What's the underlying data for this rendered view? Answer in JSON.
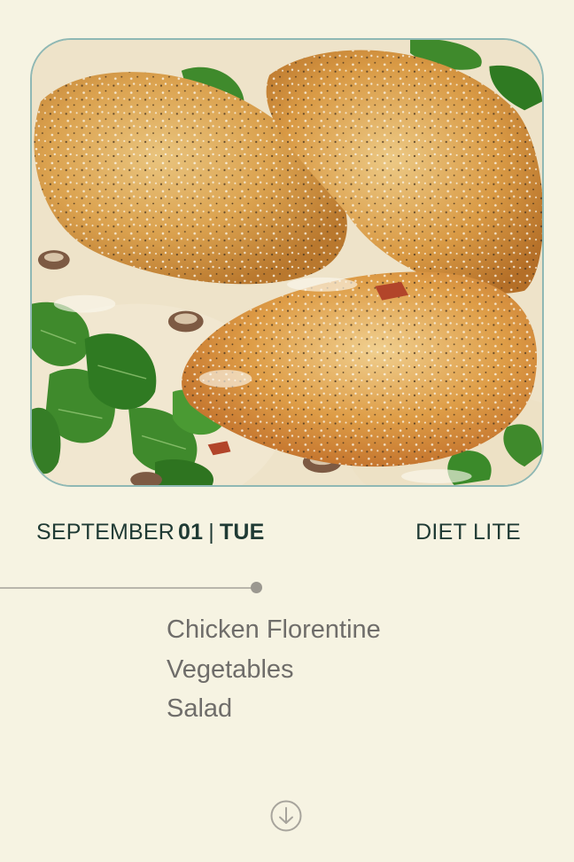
{
  "meal_card": {
    "photo_icon": "food-photo",
    "date": {
      "month": "SEPTEMBER",
      "day": "01",
      "separator": "|",
      "weekday": "TUE"
    },
    "plan": "DIET LITE",
    "menu_items": [
      "Chicken Florentine",
      "Vegetables",
      "Salad"
    ],
    "scroll_icon": "arrow-down-circle-icon"
  },
  "colors": {
    "background": "#f6f3e2",
    "photo_border": "#8fb8b4",
    "heading_text": "#1f3a34",
    "menu_text": "#6f6d6a",
    "divider": "#b9b6ab"
  }
}
